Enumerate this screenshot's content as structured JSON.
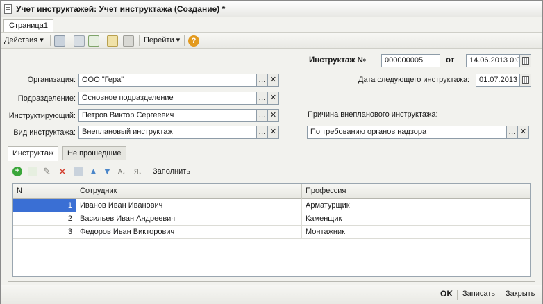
{
  "window": {
    "title": "Учет инструктажей: Учет инструктажа (Создание) *"
  },
  "page_tabs": [
    "Страница1"
  ],
  "toolbar": {
    "actions_label": "Действия ▾",
    "goto_label": "Перейти ▾",
    "help_label": "?"
  },
  "header": {
    "number_label": "Инструктаж №",
    "number_value": "000000005",
    "date_label": "от",
    "date_value": "14.06.2013 0:0",
    "next_date_label": "Дата следующего инструктажа:",
    "next_date_value": "01.07.2013"
  },
  "form": {
    "organization_label": "Организация:",
    "organization_value": "ООО \"Гера\"",
    "department_label": "Подразделение:",
    "department_value": "Основное подразделение",
    "instructor_label": "Инструктирующий:",
    "instructor_value": "Петров Виктор Сергеевич",
    "type_label": "Вид инструктажа:",
    "type_value": "Внеплановый инструктаж",
    "reason_label": "Причина внепланового инструктажа:",
    "reason_value": "По требованию органов надзора"
  },
  "field_buttons": {
    "choose": "...",
    "clear": "✕"
  },
  "tabs": [
    "Инструктаж",
    "Не прошедшие"
  ],
  "table_toolbar": {
    "fill_label": "Заполнить"
  },
  "table": {
    "columns": [
      "N",
      "Сотрудник",
      "Профессия"
    ],
    "rows": [
      {
        "n": "1",
        "employee": "Иванов Иван Иванович",
        "profession": "Арматурщик"
      },
      {
        "n": "2",
        "employee": "Васильев Иван Андреевич",
        "profession": "Каменщик"
      },
      {
        "n": "3",
        "employee": "Федоров Иван Викторович",
        "profession": "Монтажник"
      }
    ]
  },
  "footer": {
    "ok_label": "OK",
    "save_label": "Записать",
    "close_label": "Закрыть"
  },
  "colors": {
    "selection": "#3a6fd4",
    "add_icon": "#3aa63a",
    "delete_icon": "#d23a2a",
    "help_icon": "#e39a1e"
  }
}
